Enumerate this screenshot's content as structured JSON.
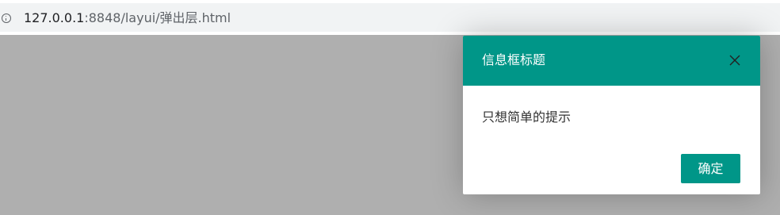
{
  "browser": {
    "url_host": "127.0.0.1",
    "url_path": ":8848/layui/弹出层.html",
    "info_icon": "info-icon"
  },
  "dialog": {
    "title": "信息框标题",
    "message": "只想简单的提示",
    "ok_label": "确定",
    "close_icon": "close-icon"
  },
  "colors": {
    "accent": "#009688",
    "overlay": "#afafaf"
  }
}
